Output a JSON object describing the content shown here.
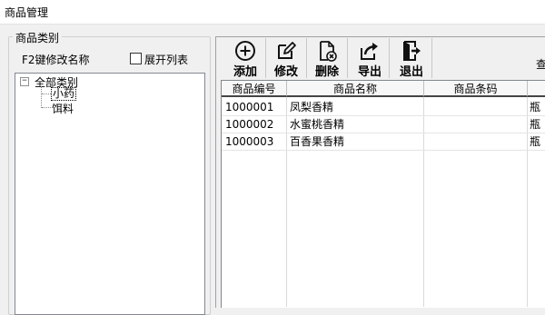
{
  "window": {
    "title": "商品管理"
  },
  "category_panel": {
    "group_title": "商品类别",
    "f2_hint": "F2键修改名称",
    "expand_checkbox_label": "展开列表",
    "expand_checked": false,
    "tree": {
      "root_label": "全部类别",
      "children": [
        "小药",
        "饵料"
      ],
      "selected_child": "小药"
    }
  },
  "toolbar": {
    "add_label": "添加",
    "edit_label": "修改",
    "delete_label": "删除",
    "export_label": "导出",
    "exit_label": "退出",
    "query_label": "查"
  },
  "grid": {
    "columns": [
      "商品编号",
      "商品名称",
      "商品条码",
      ""
    ],
    "rows": [
      {
        "code": "1000001",
        "name": "凤梨香精",
        "barcode": "",
        "unit": "瓶"
      },
      {
        "code": "1000002",
        "name": "水蜜桃香精",
        "barcode": "",
        "unit": "瓶"
      },
      {
        "code": "1000003",
        "name": "百香果香精",
        "barcode": "",
        "unit": "瓶"
      }
    ]
  },
  "icons": [
    "add-circle-icon",
    "edit-icon",
    "delete-document-icon",
    "export-icon",
    "exit-door-icon"
  ]
}
